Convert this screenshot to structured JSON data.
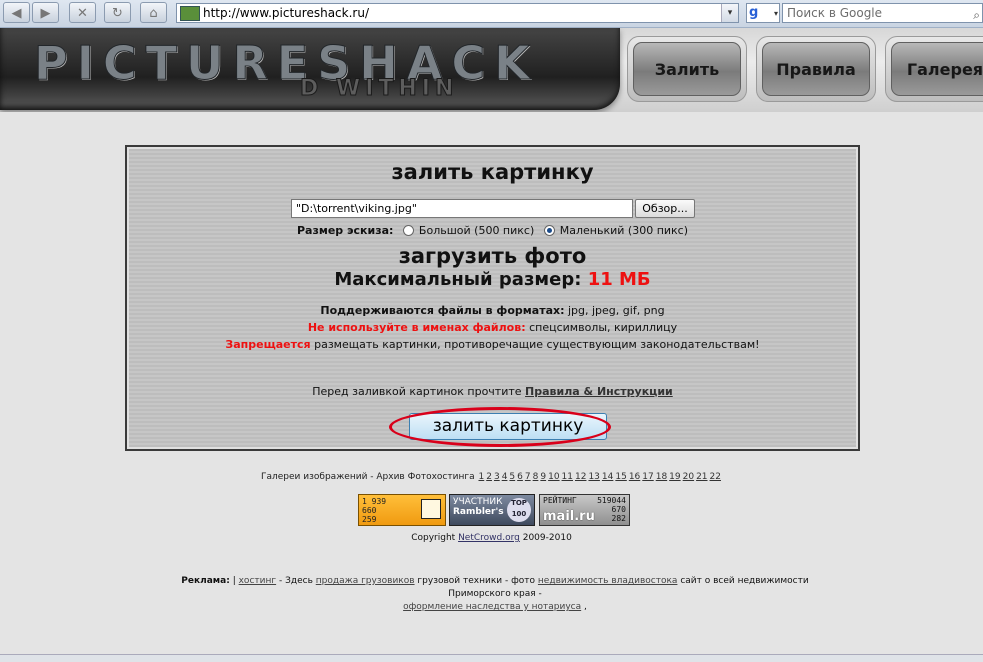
{
  "browser": {
    "url": "http://www.pictureshack.ru/",
    "search_placeholder": "Поиск в Google",
    "google_label": "g",
    "back_icon": "back-arrow-icon",
    "forward_icon": "forward-arrow-icon",
    "dropdown_glyph": "▾",
    "search_glyph": "⌕"
  },
  "header": {
    "logo_main": "PICTURESHACK",
    "logo_sub": "D WITHIN",
    "nav": [
      {
        "label": "Залить"
      },
      {
        "label": "Правила"
      },
      {
        "label": "Галерея"
      }
    ]
  },
  "upload": {
    "title": "залить картинку",
    "file_value": "\"D:\\torrent\\viking.jpg\"",
    "browse_label": "Обзор...",
    "size_label": "Размер эскиза:",
    "size_large": "Большой (500 пикс)",
    "size_small": "Маленький (300 пикс)",
    "selected_size": "small",
    "upload_heading": "загрузить фото",
    "max_size_label": "Максимальный размер:",
    "max_size_value": "11 МБ",
    "formats_label": "Поддерживаются файлы в форматах:",
    "formats_value": "jpg, jpeg, gif, png",
    "no_use_label": "Не используйте в именах файлов:",
    "no_use_value": "спецсимволы, кириллицу",
    "forbidden_label": "Запрещается",
    "forbidden_value": "размещать картинки, противоречащие существующим законодательствам!",
    "read_before": "Перед заливкой картинок прочтите",
    "rules_link": "Правила & Инструкции",
    "submit_label": "залить картинку"
  },
  "footer": {
    "galleries_label": "Галереи изображений - Архив Фотохостинга",
    "gallery_pages": [
      "1",
      "2",
      "3",
      "4",
      "5",
      "6",
      "7",
      "8",
      "9",
      "10",
      "11",
      "12",
      "13",
      "14",
      "15",
      "16",
      "17",
      "18",
      "19",
      "20",
      "21",
      "22"
    ],
    "counter1": [
      "1 939",
      "660",
      "259"
    ],
    "counter2_title": "УЧАСТНИК",
    "counter2_name": "Rambler's",
    "counter2_badge": "TOP 100",
    "counter3_title": "РЕЙТИНГ",
    "counter3_values": [
      "519044",
      "670",
      "282"
    ],
    "counter3_logo": "mail.ru",
    "copyright_prefix": "Copyright",
    "copyright_link": "NetCrowd.org",
    "copyright_years": "2009-2010",
    "ads_label": "Реклама:",
    "ads_sep": "|",
    "ad_hosting": "хостинг",
    "ad_text1": "- Здесь",
    "ad_trucks": "продажа грузовиков",
    "ad_text2": "грузовой техники - фото",
    "ad_realty": "недвижимость владивостока",
    "ad_text3": "сайт о всей недвижимости Приморского края -",
    "ad_notary": "оформление наследства у нотариуса",
    "ad_end": ","
  },
  "colors": {
    "accent_red": "#ee1111",
    "highlight_circle": "#d9001a"
  }
}
